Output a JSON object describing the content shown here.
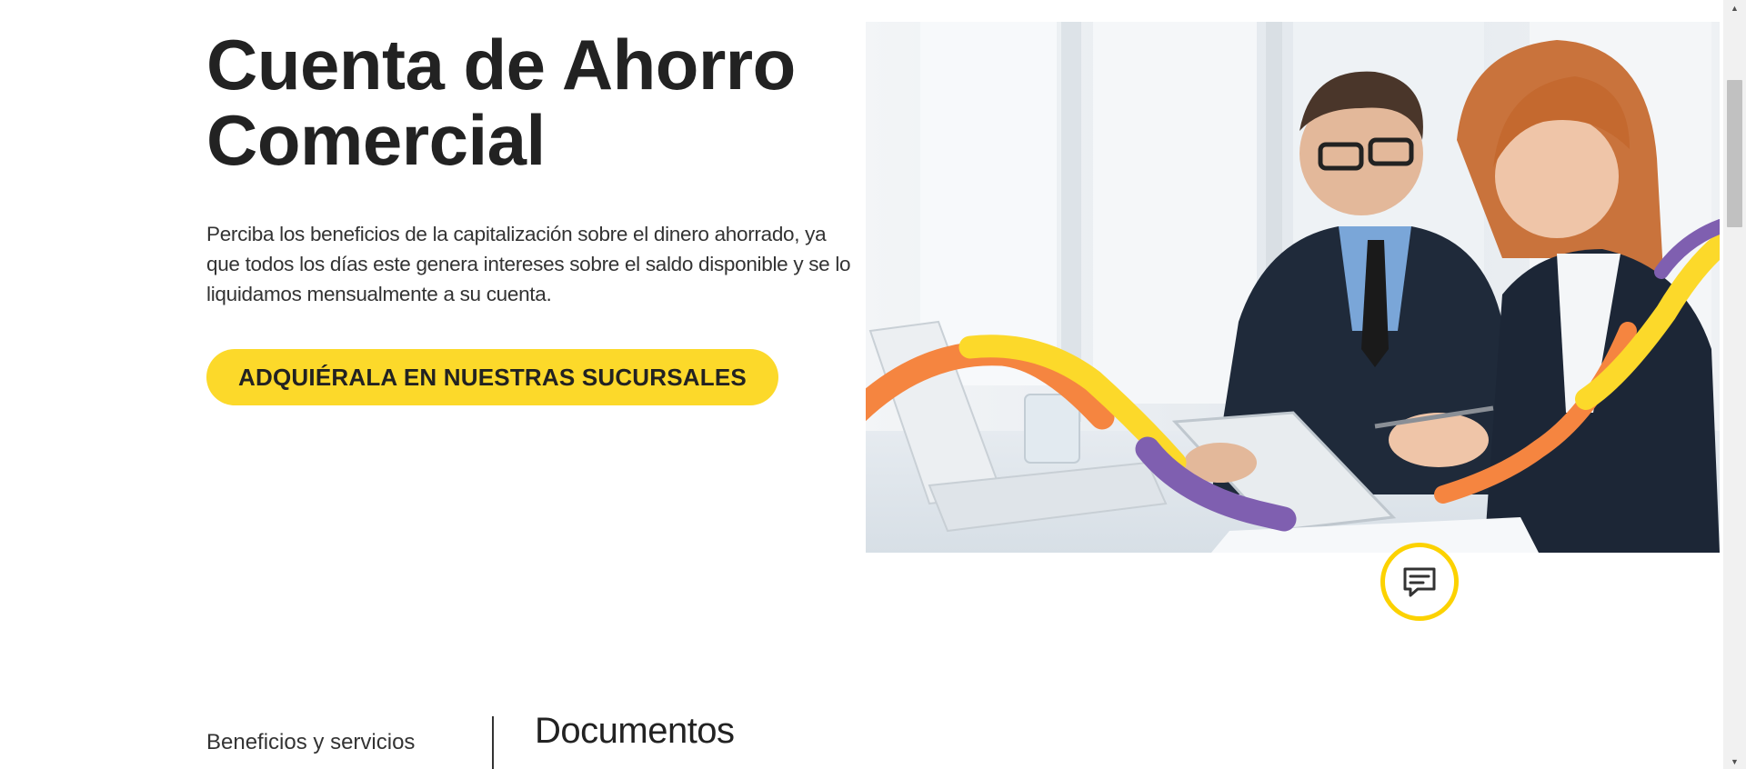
{
  "hero": {
    "title": "Cuenta de Ahorro Comercial",
    "description": "Perciba los beneficios de la capitalización sobre el dinero ahorrado, ya que todos los días este genera intereses sobre el saldo disponible y se lo liquidamos mensualmente a su cuenta.",
    "cta_label": "ADQUIÉRALA EN NUESTRAS SUCURSALES",
    "image_icon": "business-people-photo-icon"
  },
  "chat": {
    "icon": "chat-bubble-icon"
  },
  "sections": {
    "nav_item": "Beneficios y servicios",
    "heading": "Documentos"
  },
  "colors": {
    "accent_yellow": "#fcd92a",
    "accent_orange": "#f58540",
    "accent_purple": "#7f5fb0",
    "text_dark": "#222222"
  }
}
